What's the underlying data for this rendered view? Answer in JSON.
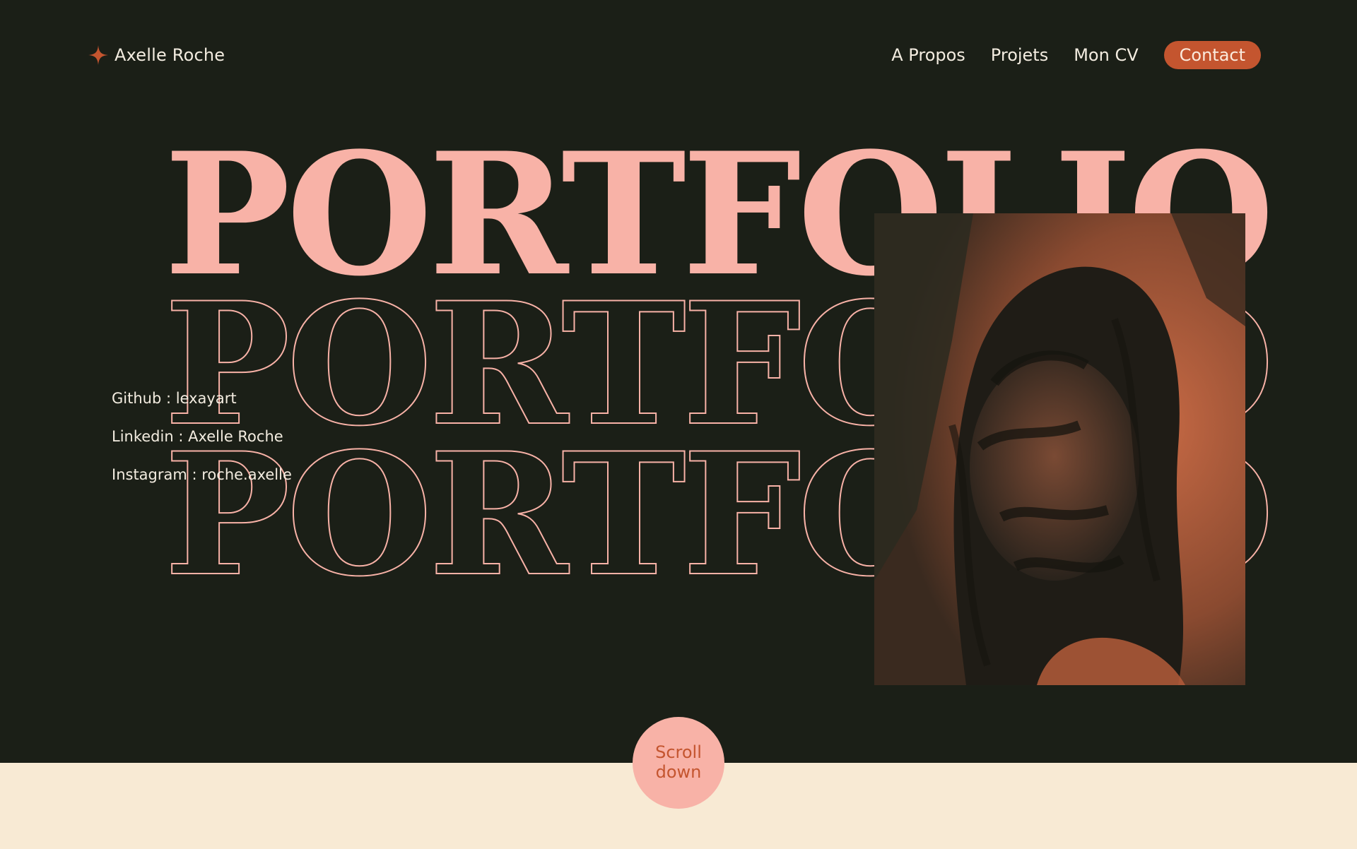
{
  "header": {
    "logo_icon": "sparkle-icon",
    "logo_text": "Axelle Roche",
    "nav": [
      {
        "label": "A Propos"
      },
      {
        "label": "Projets"
      },
      {
        "label": "Mon CV"
      }
    ],
    "contact_label": "Contact"
  },
  "hero": {
    "word": "PORTFOLIO"
  },
  "socials": [
    {
      "label": "Github : lexayart"
    },
    {
      "label": "Linkedin : Axelle Roche"
    },
    {
      "label": "Instagram : roche.axelle"
    }
  ],
  "scroll": {
    "line1": "Scroll",
    "line2": "down"
  },
  "colors": {
    "background": "#1b1f17",
    "accent": "#c4552f",
    "pink": "#f8b2a7",
    "cream": "#f8ead4",
    "text": "#f3ece0"
  }
}
